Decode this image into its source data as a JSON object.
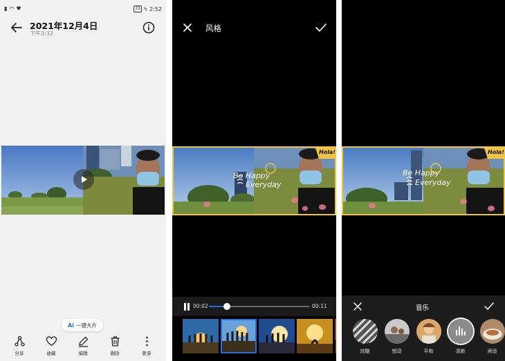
{
  "status": {
    "time": "2:52",
    "battery": "73"
  },
  "gallery": {
    "date": "2021年12月4日",
    "time": "下午3:32",
    "ai_button": {
      "icon": "Ai",
      "label": "一键大片"
    },
    "toolbar": [
      {
        "icon": "share-icon",
        "label": "分享"
      },
      {
        "icon": "heart-icon",
        "label": "收藏"
      },
      {
        "icon": "pencil-icon",
        "label": "编辑"
      },
      {
        "icon": "trash-icon",
        "label": "删除"
      },
      {
        "icon": "more-vertical-icon",
        "label": "更多"
      }
    ]
  },
  "style_editor": {
    "title": "风格",
    "overlay": {
      "line1": "Be Happy",
      "line2": "Everyday",
      "sticker": "Hola!"
    },
    "player": {
      "current": "00:02",
      "total": "00:11",
      "progress": 0.18
    },
    "thumbnails": 5,
    "selected_thumbnail": 1
  },
  "music_editor": {
    "title": "音乐",
    "overlay": {
      "line1": "Be Happy",
      "line2": "Everyday",
      "sticker": "Hola!"
    },
    "tracks": [
      {
        "label": "炫酷",
        "selected": false
      },
      {
        "label": "悦动",
        "selected": false
      },
      {
        "label": "平和",
        "selected": false
      },
      {
        "label": "清新",
        "selected": true
      },
      {
        "label": "闲适",
        "selected": false
      }
    ]
  },
  "colors": {
    "accent": "#1e6fe8",
    "frame": "#f0c543"
  }
}
